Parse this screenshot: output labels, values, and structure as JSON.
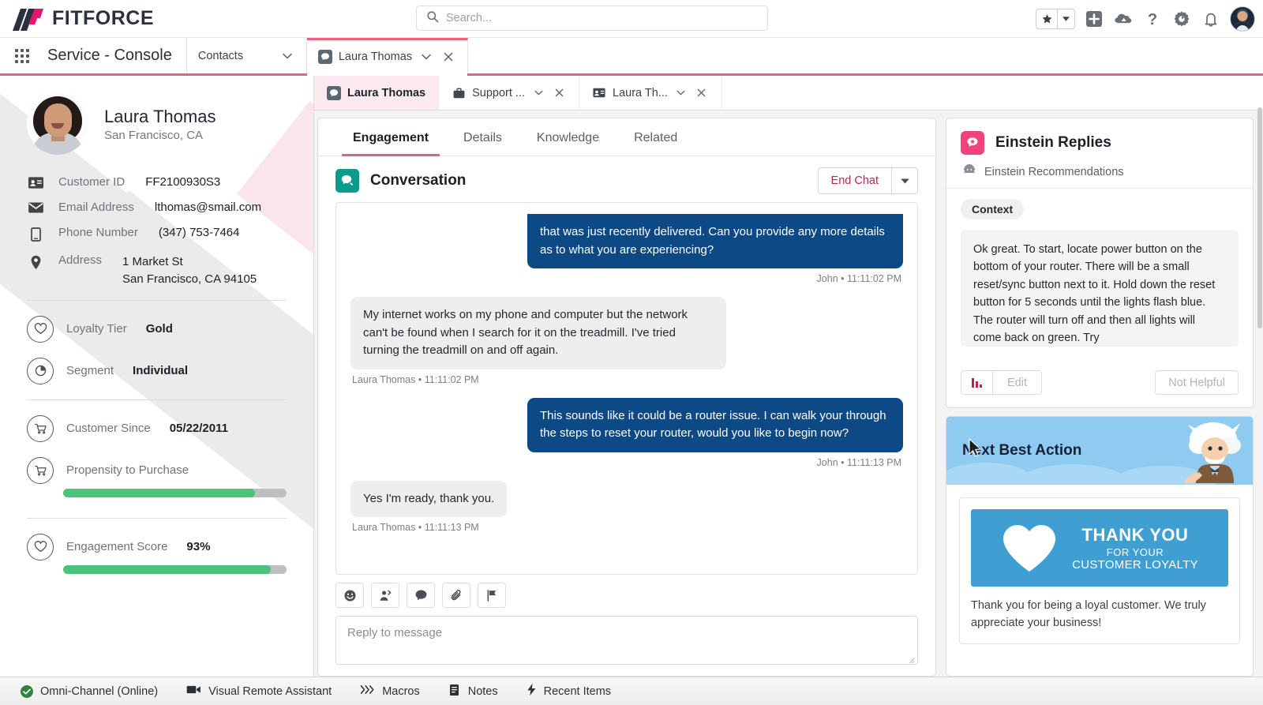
{
  "brand": {
    "name": "FITFORCE"
  },
  "search": {
    "placeholder": "Search...",
    "icon": "search-icon"
  },
  "header_icons": [
    {
      "name": "favorites-star-icon",
      "glyph": "★"
    },
    {
      "name": "favorites-dropdown-icon",
      "glyph": "▼"
    },
    {
      "name": "add-icon",
      "glyph": "+"
    },
    {
      "name": "cloud-setup-icon",
      "glyph": "☁"
    },
    {
      "name": "help-icon",
      "glyph": "?"
    },
    {
      "name": "settings-gear-icon",
      "glyph": "⚙"
    },
    {
      "name": "notifications-bell-icon",
      "glyph": "🔔"
    },
    {
      "name": "user-avatar",
      "glyph": ""
    }
  ],
  "app_nav": {
    "waffle_label": "app-launcher",
    "console_name": "Service - Console",
    "tabs": [
      {
        "label": "Contacts",
        "icon": "",
        "active": false,
        "has_caret": true,
        "has_close": false
      },
      {
        "label": "Laura Thomas",
        "icon": "chat-object-icon",
        "active": true,
        "has_caret": true,
        "has_close": true
      }
    ]
  },
  "subtabs": [
    {
      "label": "Laura Thomas",
      "icon": "chat-object-icon",
      "active": true,
      "has_caret": false,
      "has_close": false
    },
    {
      "label": "Support ...",
      "icon": "case-briefcase-icon",
      "active": false,
      "has_caret": true,
      "has_close": true
    },
    {
      "label": "Laura Th...",
      "icon": "contact-card-icon",
      "active": false,
      "has_caret": true,
      "has_close": true
    }
  ],
  "contact": {
    "name": "Laura Thomas",
    "location": "San Francisco, CA",
    "fields": [
      {
        "icon": "id-card-icon",
        "label": "Customer ID",
        "value": "FF2100930S3"
      },
      {
        "icon": "envelope-icon",
        "label": "Email Address",
        "value": "lthomas@smail.com"
      },
      {
        "icon": "mobile-phone-icon",
        "label": "Phone Number",
        "value": "(347) 753-7464"
      },
      {
        "icon": "location-pin-icon",
        "label": "Address",
        "value": "1 Market St\nSan Francisco, CA 94105"
      }
    ],
    "metrics_group_1": [
      {
        "icon": "heart-circle-icon",
        "label": "Loyalty Tier",
        "value": "Gold"
      },
      {
        "icon": "pie-chart-circle-icon",
        "label": "Segment",
        "value": "Individual"
      }
    ],
    "metrics_group_2": [
      {
        "icon": "cart-circle-icon",
        "label": "Customer Since",
        "value": "05/22/2011",
        "bar": null
      },
      {
        "icon": "cart-circle-icon",
        "label": "Propensity to Purchase",
        "value": "",
        "bar": 86
      }
    ],
    "metrics_group_3": [
      {
        "icon": "heart-circle-icon",
        "label": "Engagement Score",
        "value": "93%",
        "bar": 93
      }
    ]
  },
  "record_tabs": [
    {
      "label": "Engagement",
      "active": true
    },
    {
      "label": "Details",
      "active": false
    },
    {
      "label": "Knowledge",
      "active": false
    },
    {
      "label": "Related",
      "active": false
    }
  ],
  "conversation": {
    "icon": "conversation-icon",
    "title": "Conversation",
    "end_chat_label": "End Chat",
    "end_chat_caret": "▼",
    "messages": [
      {
        "sender_type": "agent",
        "text": "that was just recently delivered. Can you provide any more details as to what you are experiencing?",
        "meta": "John • 11:11:02 PM",
        "clipped": true
      },
      {
        "sender_type": "customer",
        "text": "My internet works on my phone and computer but the network can't be found when I search for it on the treadmill. I've tried turning the treadmill on and off again.",
        "meta": "Laura Thomas • 11:11:02 PM",
        "clipped": false
      },
      {
        "sender_type": "agent",
        "text": "This sounds like it could be a router issue. I can walk your through the steps to reset your router, would you like to begin now?",
        "meta": "John • 11:11:13 PM",
        "clipped": false
      },
      {
        "sender_type": "customer",
        "text": "Yes I'm ready, thank you.",
        "meta": "Laura Thomas • 11:11:13 PM",
        "clipped": false
      }
    ],
    "tools": [
      {
        "name": "emoji-icon"
      },
      {
        "name": "transfer-chat-icon"
      },
      {
        "name": "quick-text-icon"
      },
      {
        "name": "attachment-paperclip-icon"
      },
      {
        "name": "flag-icon"
      }
    ],
    "reply_placeholder": "Reply to message"
  },
  "einstein": {
    "icon": "einstein-replies-icon",
    "title": "Einstein Replies",
    "subtitle_icon": "einstein-avatar-icon",
    "subtitle": "Einstein Recommendations",
    "context_chip": "Context",
    "suggestion": "Ok great. To start, locate power button on the bottom of your router. There will be a small reset/sync button next to it. Hold down the reset button for 5 seconds until the lights flash blue. The router will turn off and then all lights will come back on green. Try",
    "insights_icon": "bar-chart-icon",
    "edit_label": "Edit",
    "not_helpful_label": "Not Helpful"
  },
  "next_best_action": {
    "title": "Next Best Action",
    "character": "einstein-character",
    "banner": {
      "heart_icon": "heart-icon",
      "line1": "THANK YOU",
      "line2": "FOR YOUR",
      "line3": "CUSTOMER LOYALTY"
    },
    "description": "Thank you for being a loyal customer. We truly appreciate your business!"
  },
  "utility_bar": [
    {
      "icon": "omni-channel-online-icon",
      "label": "Omni-Channel (Online)"
    },
    {
      "icon": "video-camera-icon",
      "label": "Visual Remote Assistant"
    },
    {
      "icon": "macros-chevrons-icon",
      "label": "Macros"
    },
    {
      "icon": "notes-icon",
      "label": "Notes"
    },
    {
      "icon": "lightning-bolt-icon",
      "label": "Recent Items"
    }
  ],
  "colors": {
    "brand_pink": "#e8617f",
    "brand_navy": "#2c2f3e",
    "agent_bubble": "#0d4a85",
    "customer_bubble": "#eeeeee",
    "progress_green": "#4ac47b",
    "einstein_pink": "#f0437e",
    "conversation_teal": "#0b9b8a",
    "nba_sky": "#8fcbf0",
    "banner_blue": "#3f9ed2",
    "end_chat_text": "#b5294f"
  }
}
